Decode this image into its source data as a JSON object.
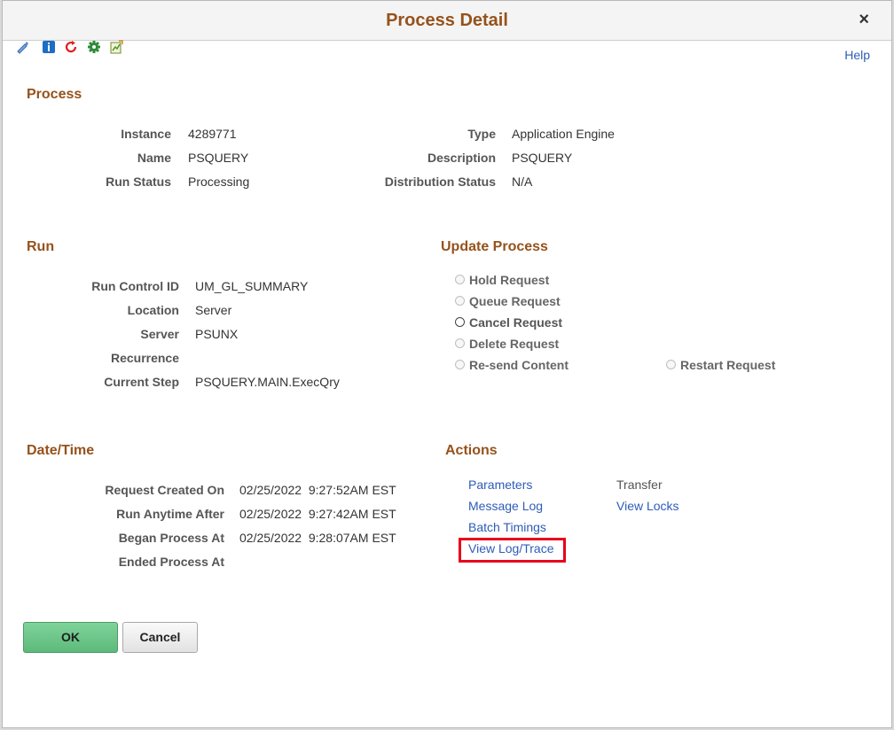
{
  "dialog": {
    "title": "Process Detail",
    "close_label": "×",
    "help_label": "Help"
  },
  "toolbar": [
    "pencil-icon",
    "info-icon",
    "refresh-icon",
    "gear-icon",
    "report-icon"
  ],
  "process": {
    "heading": "Process",
    "instance_label": "Instance",
    "instance": "4289771",
    "name_label": "Name",
    "name": "PSQUERY",
    "run_status_label": "Run Status",
    "run_status": "Processing",
    "type_label": "Type",
    "type": "Application Engine",
    "description_label": "Description",
    "description": "PSQUERY",
    "dist_status_label": "Distribution Status",
    "dist_status": "N/A"
  },
  "run": {
    "heading": "Run",
    "run_control_label": "Run Control ID",
    "run_control": "UM_GL_SUMMARY",
    "location_label": "Location",
    "location": "Server",
    "server_label": "Server",
    "server": "PSUNX",
    "recurrence_label": "Recurrence",
    "recurrence": "",
    "current_step_label": "Current Step",
    "current_step": "PSQUERY.MAIN.ExecQry"
  },
  "update": {
    "heading": "Update Process",
    "hold": "Hold Request",
    "queue": "Queue Request",
    "cancel": "Cancel Request",
    "delete": "Delete Request",
    "resend": "Re-send Content",
    "restart": "Restart Request"
  },
  "datetime": {
    "heading": "Date/Time",
    "created_label": "Request Created On",
    "created": "02/25/2022  9:27:52AM EST",
    "anytime_label": "Run Anytime After",
    "anytime": "02/25/2022  9:27:42AM EST",
    "began_label": "Began Process At",
    "began": "02/25/2022  9:28:07AM EST",
    "ended_label": "Ended Process At",
    "ended": ""
  },
  "actions": {
    "heading": "Actions",
    "parameters": "Parameters",
    "message_log": "Message Log",
    "batch_timings": "Batch Timings",
    "view_log": "View Log/Trace",
    "transfer": "Transfer",
    "view_locks": "View Locks"
  },
  "buttons": {
    "ok": "OK",
    "cancel": "Cancel"
  },
  "colors": {
    "heading": "#95521c",
    "link": "#2e5cb8",
    "highlight": "#e8001c",
    "ok": "#6cc589"
  }
}
